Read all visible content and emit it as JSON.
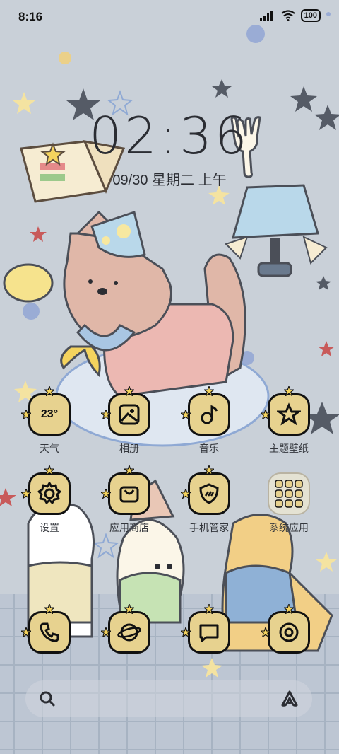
{
  "status_bar": {
    "time": "8:16",
    "battery": "100",
    "icons": [
      "signal-icon",
      "wifi-icon",
      "battery-icon"
    ]
  },
  "lock_clock": {
    "time": "02:36",
    "date": "09/30 星期二 上午"
  },
  "apps_row1": [
    {
      "label": "天气",
      "icon": "weather-icon",
      "overlay": "23°"
    },
    {
      "label": "相册",
      "icon": "gallery-icon"
    },
    {
      "label": "音乐",
      "icon": "music-icon"
    },
    {
      "label": "主题壁纸",
      "icon": "themes-icon"
    }
  ],
  "apps_row2": [
    {
      "label": "设置",
      "icon": "gear-icon"
    },
    {
      "label": "应用商店",
      "icon": "app-store-icon"
    },
    {
      "label": "手机管家",
      "icon": "security-icon"
    },
    {
      "label": "系统应用",
      "icon": "folder-icon"
    }
  ],
  "dock_apps": [
    {
      "icon": "phone-icon"
    },
    {
      "icon": "browser-icon"
    },
    {
      "icon": "messages-icon"
    },
    {
      "icon": "camera-icon"
    }
  ],
  "colors": {
    "tile_yellow": "#e7d28f",
    "tile_blue": "#a9c6d6",
    "outline": "#111111",
    "wallpaper": "#c9d0d8"
  }
}
